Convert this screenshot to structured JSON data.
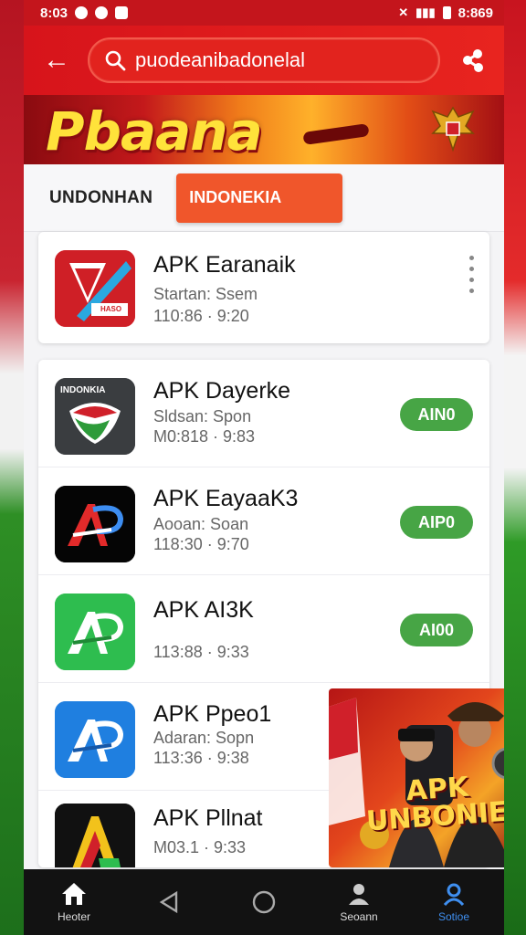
{
  "status_bar": {
    "time": "8:03",
    "battery_time": "8:869"
  },
  "search": {
    "value": "puodeanibadonelal"
  },
  "banner": {
    "title": "Pbaana"
  },
  "tabs": [
    {
      "label": "UNDONHAN",
      "active": false
    },
    {
      "label": "INDONEKIA",
      "active": true
    }
  ],
  "apps": [
    {
      "name": "APK Earanaik",
      "sub": "Startan: Ssem",
      "time": "110:86 · 9:20",
      "icon": "red-arrow-app-icon",
      "icon_label": "HASO",
      "action": "menu"
    },
    {
      "name": "APK Dayerke",
      "sub": "Sldsan: Spon",
      "time": "M0:818 · 9:83",
      "icon": "indonesia-shield-app-icon",
      "icon_label": "INDONKIA",
      "action": "AIN0"
    },
    {
      "name": "APK EayaaK3",
      "sub": "Aooan: Soan",
      "time": "118:30 · 9:70",
      "icon": "ap-black-app-icon",
      "action": "AIP0"
    },
    {
      "name": "APK AI3K",
      "sub": "",
      "time": "113:88 · 9:33",
      "icon": "ap-green-app-icon",
      "action": "AI00"
    },
    {
      "name": "APK Ppeo1",
      "sub": "Adaran: Sopn",
      "time": "113:36 · 9:38",
      "icon": "ap-blue-app-icon"
    },
    {
      "name": "APK Pllnat",
      "sub": "",
      "time": "M03.1 · 9:33",
      "icon": "a-color-app-icon"
    }
  ],
  "promo": {
    "text": "APK UNBONIEA"
  },
  "navbar": [
    {
      "label": "Heoter",
      "icon": "home-icon",
      "active": false
    },
    {
      "label": "",
      "icon": "back-triangle-icon",
      "active": false
    },
    {
      "label": "",
      "icon": "home-circle-icon",
      "active": false
    },
    {
      "label": "Seoann",
      "icon": "person-icon",
      "active": false
    },
    {
      "label": "Sotioe",
      "icon": "profile-icon",
      "active": true
    }
  ],
  "colors": {
    "primary_red": "#d7141b",
    "accent_orange": "#f0562b",
    "add_green": "#47a545",
    "active_blue": "#3f8ff0"
  }
}
